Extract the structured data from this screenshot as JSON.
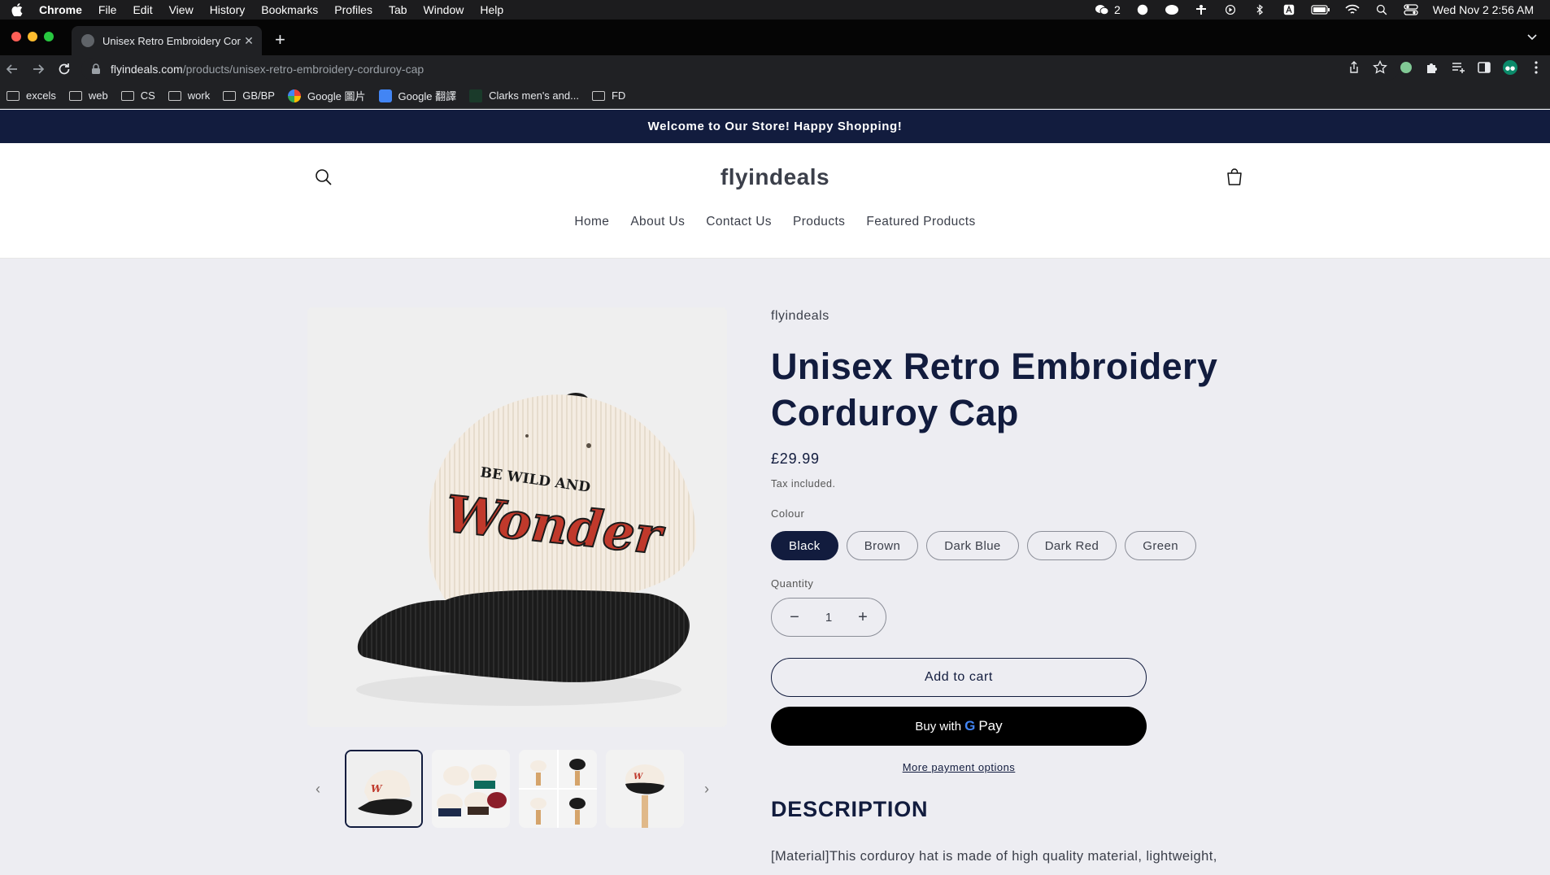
{
  "os_menubar": {
    "app_name": "Chrome",
    "menus": [
      "File",
      "Edit",
      "View",
      "History",
      "Bookmarks",
      "Profiles",
      "Tab",
      "Window",
      "Help"
    ],
    "wechat_count": "2",
    "datetime": "Wed Nov 2  2:56 AM"
  },
  "browser": {
    "tab_title": "Unisex Retro Embroidery Cord",
    "url_domain": "flyindeals.com",
    "url_path": "/products/unisex-retro-embroidery-corduroy-cap",
    "bookmarks": [
      {
        "label": "excels",
        "type": "folder"
      },
      {
        "label": "web",
        "type": "folder"
      },
      {
        "label": "CS",
        "type": "folder"
      },
      {
        "label": "work",
        "type": "folder"
      },
      {
        "label": "GB/BP",
        "type": "folder"
      },
      {
        "label": "Google 圖片",
        "type": "google"
      },
      {
        "label": "Google 翻譯",
        "type": "translate"
      },
      {
        "label": "Clarks men's and...",
        "type": "site"
      },
      {
        "label": "FD",
        "type": "folder"
      }
    ]
  },
  "store": {
    "announcement": "Welcome to Our Store! Happy Shopping!",
    "logo": "flyindeals",
    "nav": [
      "Home",
      "About Us",
      "Contact Us",
      "Products",
      "Featured Products"
    ]
  },
  "product": {
    "vendor": "flyindeals",
    "title": "Unisex Retro Embroidery Corduroy Cap",
    "price": "£29.99",
    "tax_note": "Tax included.",
    "colour_label": "Colour",
    "colours": [
      "Black",
      "Brown",
      "Dark Blue",
      "Dark Red",
      "Green"
    ],
    "selected_colour": "Black",
    "quantity_label": "Quantity",
    "quantity": "1",
    "add_to_cart": "Add to cart",
    "buy_with": "Buy with",
    "pay_word": "Pay",
    "more_payment": "More payment options",
    "description_heading": "DESCRIPTION",
    "description_text": "[Material]This corduroy hat is made of high quality material, lightweight,",
    "cap_text_top": "BE WILD AND",
    "cap_text_script": "Wonder"
  },
  "colors": {
    "brand_navy": "#121c3e",
    "page_bg": "#ededf2"
  }
}
